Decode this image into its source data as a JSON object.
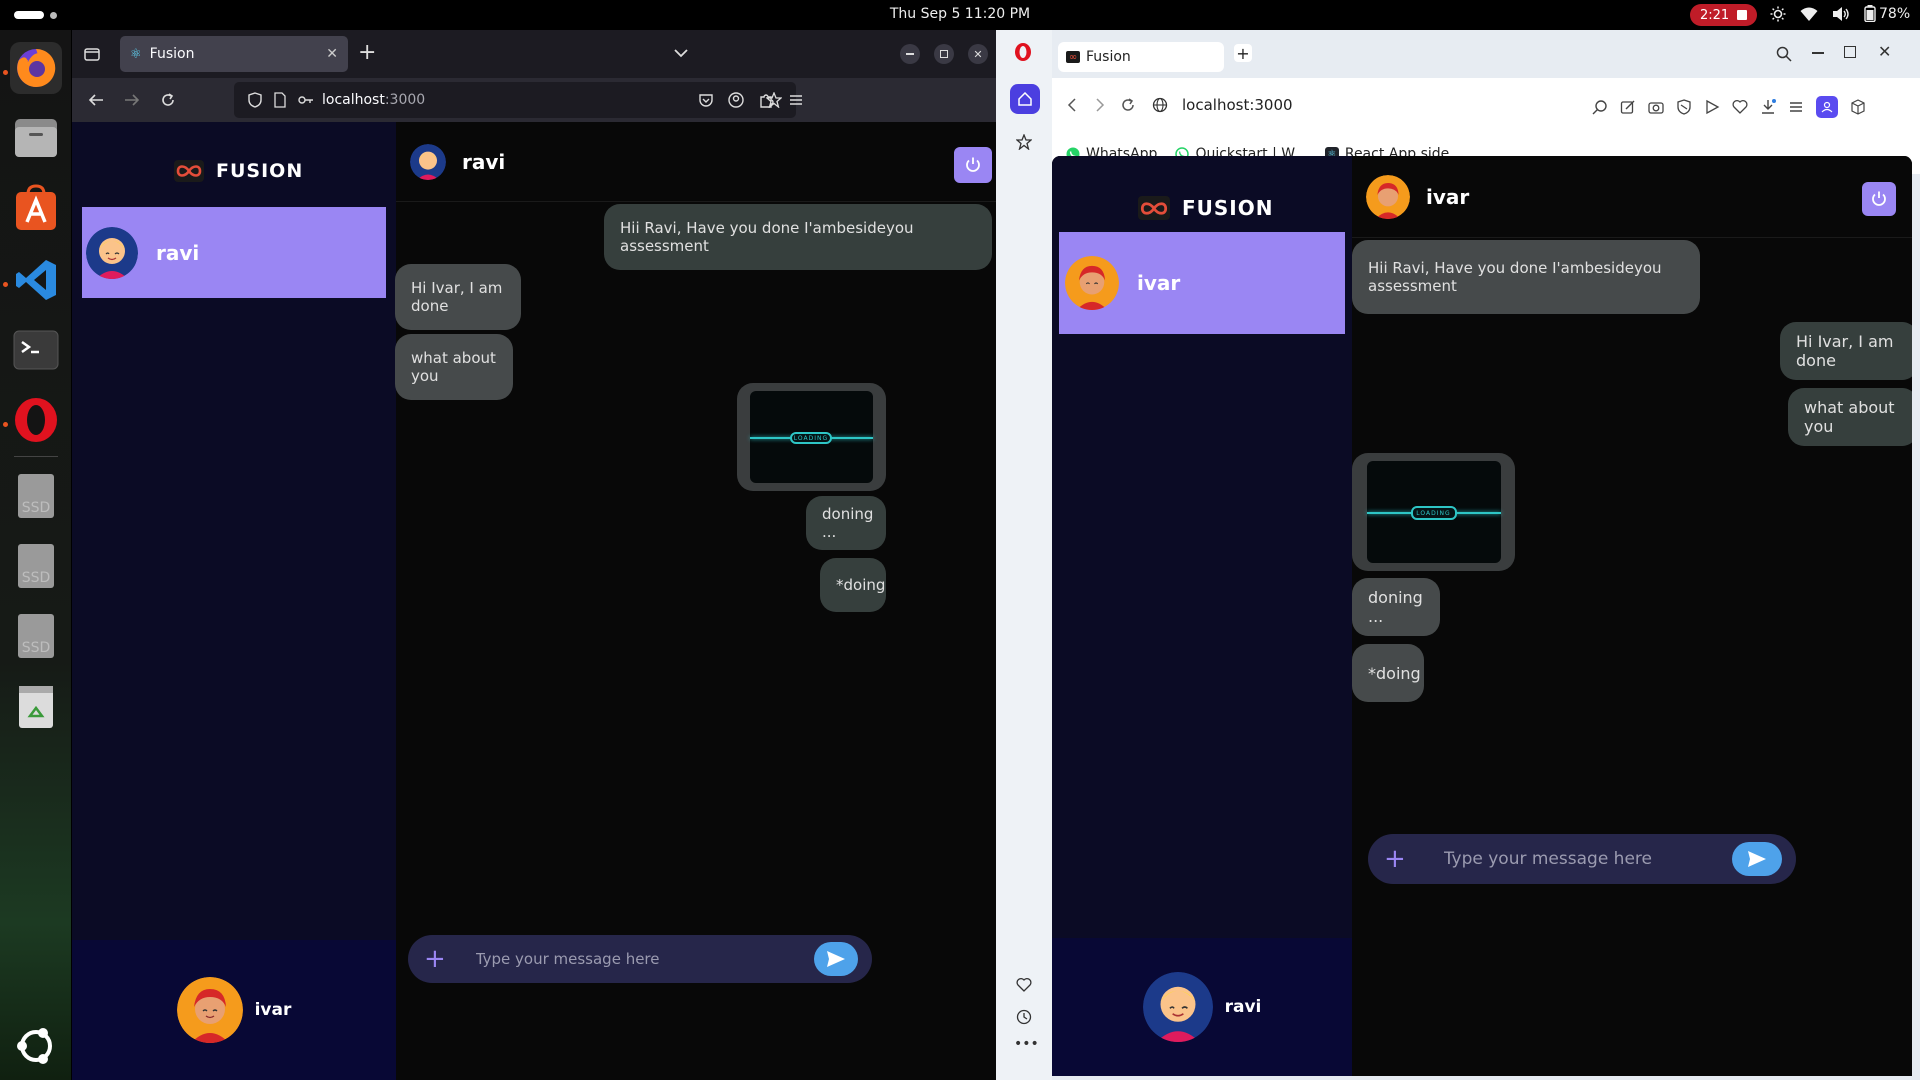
{
  "topbar": {
    "clock": "Thu Sep 5  11:20 PM",
    "recording_time": "2:21",
    "battery": "78%"
  },
  "dock": {
    "items": [
      "firefox-icon",
      "files-icon",
      "app-center-icon",
      "vscode-icon",
      "terminal-icon",
      "opera-icon",
      "ssd-icon",
      "ssd-icon",
      "ssd-icon",
      "trash-icon",
      "ubuntu-apps-icon"
    ],
    "ssd_label": "SSD"
  },
  "firefox": {
    "tab_title": "Fusion",
    "url_host": "localhost",
    "url_port": ":3000",
    "app": {
      "brand": "FUSION",
      "contact_name": "ravi",
      "chat_title": "ravi",
      "me_name": "ivar",
      "messages": [
        {
          "text": "Hii Ravi, Have you done I'ambesideyou assessment",
          "dir": "sent"
        },
        {
          "text": "Hi Ivar, I am done",
          "dir": "recv"
        },
        {
          "text": "what about you",
          "dir": "recv"
        },
        {
          "text": "LOADING",
          "dir": "sent"
        },
        {
          "text": "doning ...",
          "dir": "sent"
        },
        {
          "text": "*doing",
          "dir": "sent"
        }
      ],
      "input_placeholder": "Type your message here"
    }
  },
  "opera": {
    "tab_title": "Fusion",
    "url": "localhost:3000",
    "bookmarks": [
      "WhatsApp",
      "Quickstart | W...",
      "React App side..."
    ],
    "app": {
      "brand": "FUSION",
      "contact_name": "ivar",
      "chat_title": "ivar",
      "me_name": "ravi",
      "messages": [
        {
          "text": "Hii Ravi, Have you done I'ambesideyou assessment",
          "dir": "recv"
        },
        {
          "text": "Hi Ivar, I am done",
          "dir": "sent"
        },
        {
          "text": "what about you",
          "dir": "sent"
        },
        {
          "text": "LOADING",
          "dir": "recv"
        },
        {
          "text": "doning ...",
          "dir": "recv"
        },
        {
          "text": "*doing",
          "dir": "recv"
        }
      ],
      "input_placeholder": "Type your message here"
    }
  },
  "colors": {
    "accent": "#9a86f3",
    "sidebar": "#0b0b25",
    "send_button": "#4ea2ea",
    "recording": "#c01c28"
  }
}
